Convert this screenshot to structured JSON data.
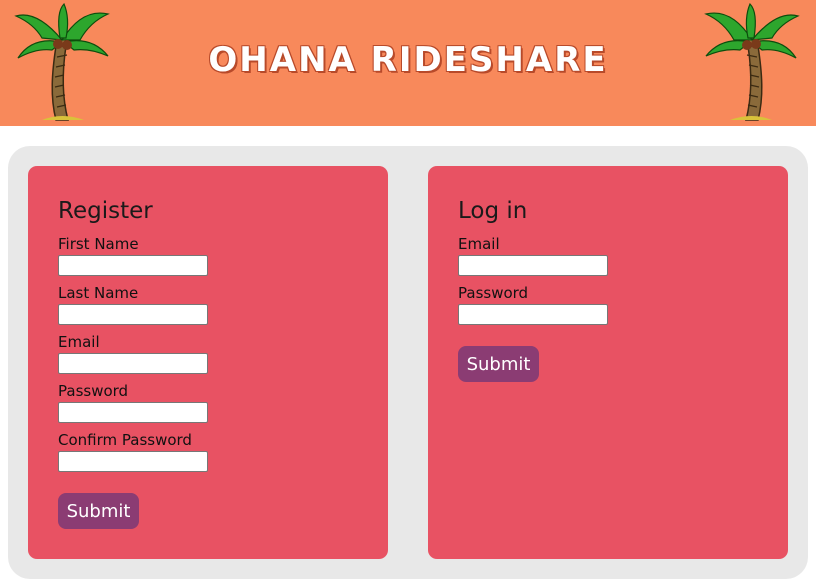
{
  "header": {
    "title": "OHANA RIDESHARE"
  },
  "register": {
    "heading": "Register",
    "fields": [
      {
        "label": "First Name",
        "value": ""
      },
      {
        "label": "Last Name",
        "value": ""
      },
      {
        "label": "Email",
        "value": ""
      },
      {
        "label": "Password",
        "value": ""
      },
      {
        "label": "Confirm Password",
        "value": ""
      }
    ],
    "submit_label": "Submit"
  },
  "login": {
    "heading": "Log in",
    "fields": [
      {
        "label": "Email",
        "value": ""
      },
      {
        "label": "Password",
        "value": ""
      }
    ],
    "submit_label": "Submit"
  },
  "colors": {
    "header_bg": "#f8895b",
    "card_bg": "#e85263",
    "button_bg": "#8b3c73",
    "frame_bg": "#e8e8e8"
  },
  "icons": {
    "header_left": "palm-tree-icon",
    "header_right": "palm-tree-icon"
  }
}
